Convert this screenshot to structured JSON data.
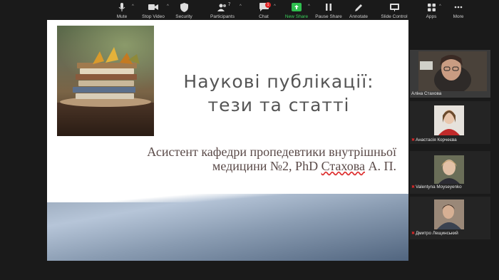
{
  "toolbar": {
    "mute": "Mute",
    "stop_video": "Stop Video",
    "security": "Security",
    "participants": "Participants",
    "participants_count": "7",
    "chat": "Chat",
    "chat_badge": "1",
    "new_share": "New Share",
    "pause_share": "Pause Share",
    "annotate": "Annotate",
    "slide_control": "Slide Control",
    "apps": "Apps",
    "more": "More"
  },
  "slide": {
    "title_line1": "Наукові  публікації:",
    "title_line2": "тези та статті",
    "subtitle_line1": "Асистент кафедри пропедевтики внутрішньої",
    "subtitle_line2_a": "медицини №2, PhD ",
    "subtitle_line2_b": "Стахова",
    "subtitle_line2_c": " А. П."
  },
  "participants": [
    {
      "name": "Аліна Стахова",
      "muted": false
    },
    {
      "name": "Анастасія Корчеєва",
      "muted": true
    },
    {
      "name": "Valentyna Moyseyenko",
      "muted": true
    },
    {
      "name": "Дмитро Лещинський",
      "muted": true
    }
  ]
}
